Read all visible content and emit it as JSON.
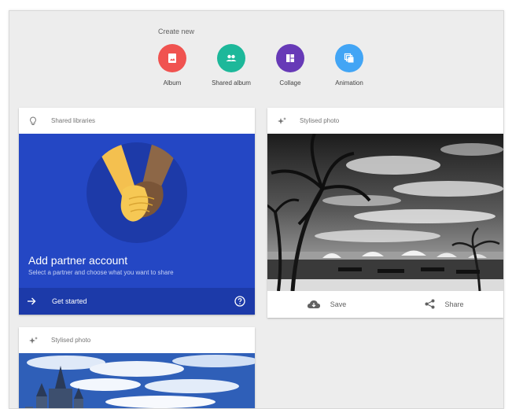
{
  "create": {
    "title": "Create new",
    "items": [
      {
        "label": "Album",
        "icon": "album-icon",
        "color": "#f05350"
      },
      {
        "label": "Shared album",
        "icon": "shared-album-icon",
        "color": "#1db89a"
      },
      {
        "label": "Collage",
        "icon": "collage-icon",
        "color": "#673ab7"
      },
      {
        "label": "Animation",
        "icon": "animation-icon",
        "color": "#42a5f5"
      }
    ]
  },
  "partner_card": {
    "header": "Shared libraries",
    "header_icon": "lightbulb-icon",
    "title": "Add partner account",
    "subtitle": "Select a partner and choose what you want to share",
    "action": "Get started",
    "action_icon": "arrow-right-icon",
    "help_icon": "help-icon",
    "background": "#2447c4"
  },
  "stylised_card_1": {
    "header": "Stylised photo",
    "header_icon": "sparkle-icon",
    "photo": "black-and-white beach with palm trees and umbrellas",
    "save": "Save",
    "save_icon": "cloud-download-icon",
    "share": "Share",
    "share_icon": "share-icon"
  },
  "stylised_card_2": {
    "header": "Stylised photo",
    "header_icon": "sparkle-icon",
    "photo": "castle under a blue cloudy sky"
  }
}
